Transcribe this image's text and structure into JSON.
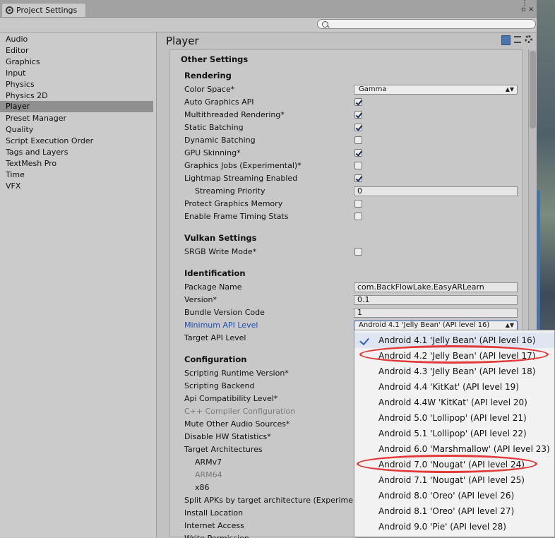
{
  "window": {
    "tab_title": "Project Settings",
    "controls": "⋮\n▫ ×"
  },
  "search": {
    "placeholder": ""
  },
  "sidebar": {
    "items": [
      {
        "label": "Audio"
      },
      {
        "label": "Editor"
      },
      {
        "label": "Graphics"
      },
      {
        "label": "Input"
      },
      {
        "label": "Physics"
      },
      {
        "label": "Physics 2D"
      },
      {
        "label": "Player",
        "selected": true
      },
      {
        "label": "Preset Manager"
      },
      {
        "label": "Quality"
      },
      {
        "label": "Script Execution Order"
      },
      {
        "label": "Tags and Layers"
      },
      {
        "label": "TextMesh Pro"
      },
      {
        "label": "Time"
      },
      {
        "label": "VFX"
      }
    ]
  },
  "main": {
    "title": "Player",
    "section": "Other Settings",
    "rendering": {
      "heading": "Rendering",
      "color_space_label": "Color Space*",
      "color_space_value": "Gamma",
      "auto_graphics_api": "Auto Graphics API",
      "multithreaded_rendering": "Multithreaded Rendering*",
      "static_batching": "Static Batching",
      "dynamic_batching": "Dynamic Batching",
      "gpu_skinning": "GPU Skinning*",
      "graphics_jobs": "Graphics Jobs (Experimental)*",
      "lightmap_streaming": "Lightmap Streaming Enabled",
      "streaming_priority": "Streaming Priority",
      "streaming_priority_value": "0",
      "protect_graphics_memory": "Protect Graphics Memory",
      "frame_timing_stats": "Enable Frame Timing Stats"
    },
    "vulkan": {
      "heading": "Vulkan Settings",
      "srgb_write_mode": "SRGB Write Mode*"
    },
    "identification": {
      "heading": "Identification",
      "package_name_label": "Package Name",
      "package_name_value": "com.BackFlowLake.EasyARLearn",
      "version_label": "Version*",
      "version_value": "0.1",
      "bundle_code_label": "Bundle Version Code",
      "bundle_code_value": "1",
      "min_api_label": "Minimum API Level",
      "min_api_value": "Android 4.1 'Jelly Bean' (API level 16)",
      "target_api_label": "Target API Level"
    },
    "configuration": {
      "heading": "Configuration",
      "scripting_runtime": "Scripting Runtime Version*",
      "scripting_backend": "Scripting Backend",
      "api_compat": "Api Compatibility Level*",
      "cpp_compiler": "C++ Compiler Configuration",
      "mute_audio": "Mute Other Audio Sources*",
      "disable_hw_stats": "Disable HW Statistics*",
      "target_arch": "Target Architectures",
      "armv7": "ARMv7",
      "arm64": "ARM64",
      "x86": "x86",
      "split_apks": "Split APKs by target architecture (Experime",
      "install_location": "Install Location",
      "internet_access": "Internet Access",
      "write_permission": "Write Permission"
    }
  },
  "api_popup": {
    "options": [
      {
        "label": "Android 4.1 'Jelly Bean' (API level 16)",
        "selected": true
      },
      {
        "label": "Android 4.2 'Jelly Bean' (API level 17)"
      },
      {
        "label": "Android 4.3 'Jelly Bean' (API level 18)"
      },
      {
        "label": "Android 4.4 'KitKat' (API level 19)"
      },
      {
        "label": "Android 4.4W 'KitKat' (API level 20)"
      },
      {
        "label": "Android 5.0 'Lollipop' (API level 21)"
      },
      {
        "label": "Android 5.1 'Lollipop' (API level 22)"
      },
      {
        "label": "Android 6.0 'Marshmallow' (API level 23)"
      },
      {
        "label": "Android 7.0 'Nougat' (API level 24)"
      },
      {
        "label": "Android 7.1 'Nougat' (API level 25)"
      },
      {
        "label": "Android 8.0 'Oreo' (API level 26)"
      },
      {
        "label": "Android 8.1 'Oreo' (API level 27)"
      },
      {
        "label": "Android 9.0 'Pie' (API level 28)"
      }
    ]
  },
  "checkboxes": {
    "auto_graphics_api": true,
    "multithreaded_rendering": true,
    "static_batching": true,
    "dynamic_batching": false,
    "gpu_skinning": true,
    "graphics_jobs": false,
    "lightmap_streaming": true,
    "protect_graphics_memory": false,
    "frame_timing_stats": false,
    "srgb_write_mode": false
  },
  "colors": {
    "highlight_ellipse": "#e23a3a",
    "link_label": "#1f4fb3",
    "check_mark": "#2a62c4"
  }
}
